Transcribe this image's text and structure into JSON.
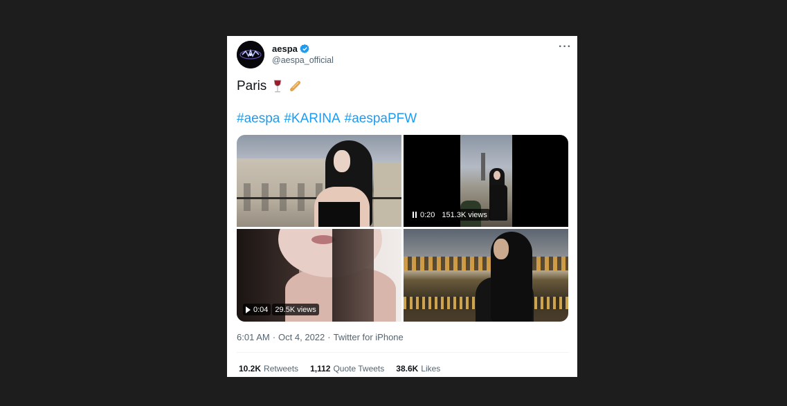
{
  "tweet": {
    "author": {
      "display_name": "aespa",
      "handle": "@aespa_official",
      "verified": true,
      "verified_color": "#1d9bf0"
    },
    "text": "Paris",
    "emojis": [
      "wine-glass",
      "baguette"
    ],
    "hashtags": [
      "#aespa",
      "#KARINA",
      "#aespaPFW"
    ],
    "hashtag_color": "#1d9bf0",
    "media": [
      {
        "type": "photo"
      },
      {
        "type": "video",
        "state": "paused",
        "time": "0:20",
        "views": "151.3K views"
      },
      {
        "type": "video",
        "state": "play",
        "time": "0:04",
        "views": "29.5K views"
      },
      {
        "type": "photo"
      }
    ],
    "timestamp": {
      "time": "6:01 AM",
      "separator1": "·",
      "date": "Oct 4, 2022",
      "separator2": "·",
      "source": "Twitter for iPhone"
    },
    "stats": {
      "retweets": {
        "count": "10.2K",
        "label": "Retweets"
      },
      "quote_tweets": {
        "count": "1,112",
        "label": "Quote Tweets"
      },
      "likes": {
        "count": "38.6K",
        "label": "Likes"
      }
    }
  },
  "icons": {
    "more": "more-options-icon",
    "verified": "verified-badge-icon"
  }
}
